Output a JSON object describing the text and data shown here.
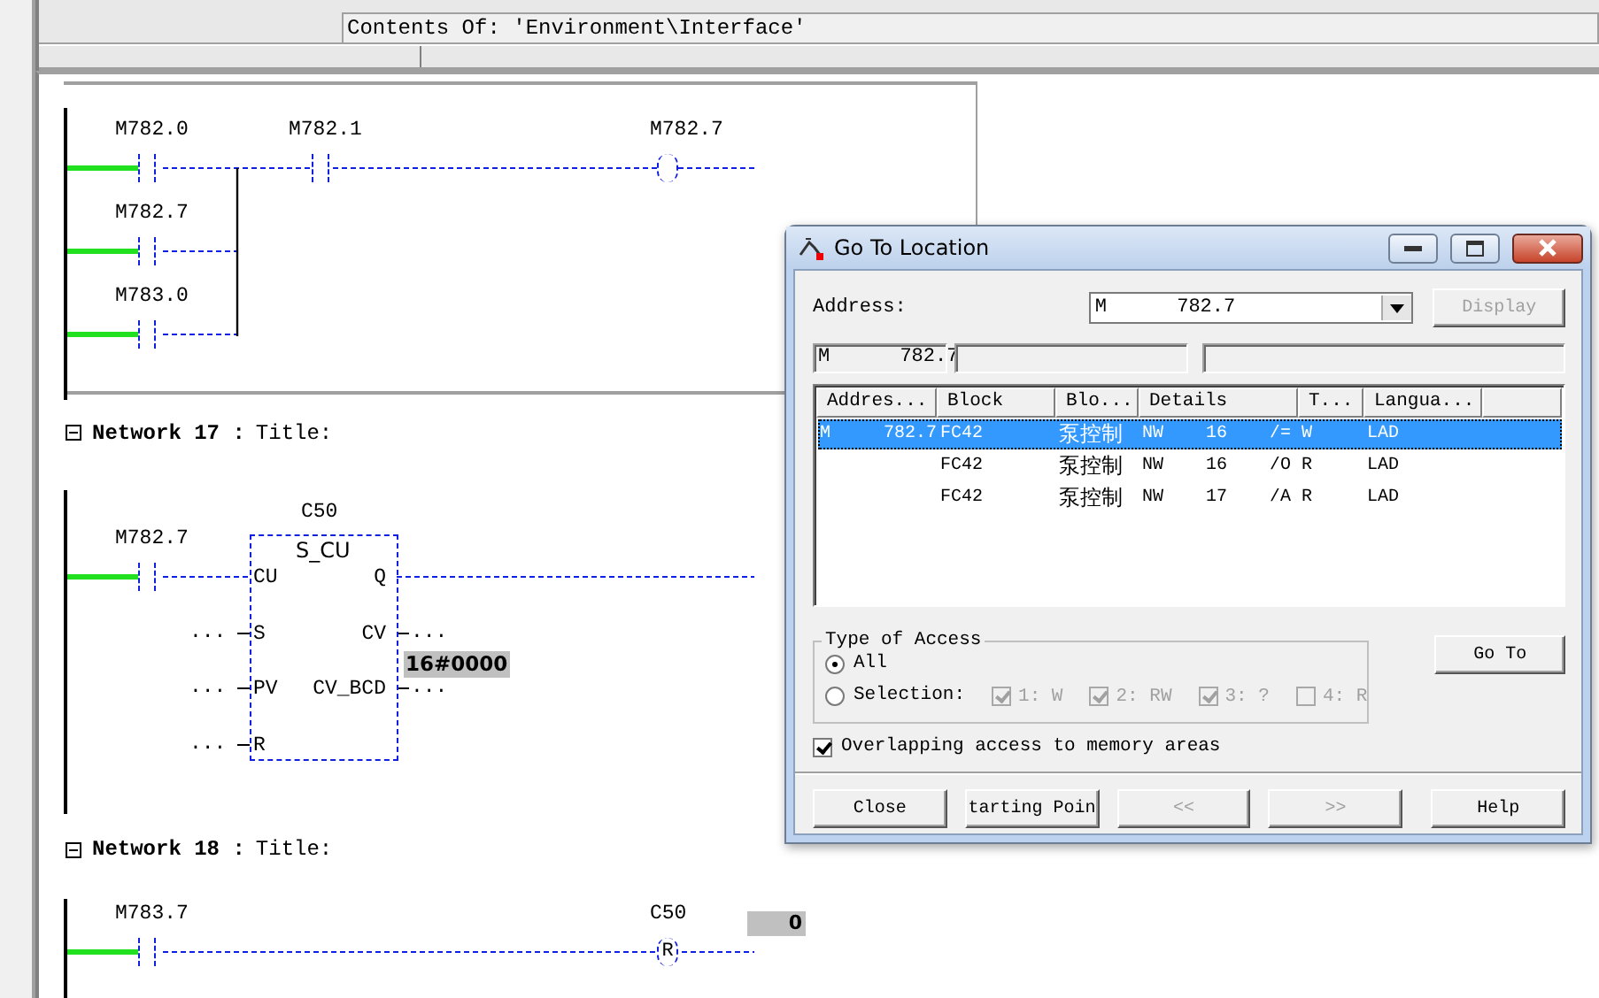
{
  "explorer": {
    "contents_label": "Contents Of: 'Environment\\Interface'"
  },
  "networks": [
    {
      "elements": [
        {
          "kind": "contact",
          "label": "M782.0"
        },
        {
          "kind": "contact",
          "label": "M782.7"
        },
        {
          "kind": "contact",
          "label": "M783.0"
        },
        {
          "kind": "contact",
          "label": "M782.1"
        },
        {
          "kind": "coil",
          "label": "M782.7"
        }
      ]
    },
    {
      "heading": "Network 17 :",
      "title": "Title:",
      "elements": [
        {
          "kind": "contact",
          "label": "M782.7"
        },
        {
          "kind": "counter",
          "label": "C50",
          "type": "S_CU",
          "inputs": [
            {
              "pin": "CU"
            },
            {
              "pin": "S",
              "wire": "..."
            },
            {
              "pin": "PV",
              "wire": "..."
            },
            {
              "pin": "R",
              "wire": "..."
            }
          ],
          "outputs": [
            {
              "pin": "Q"
            },
            {
              "pin": "CV",
              "wire": "..."
            },
            {
              "pin": "CV_BCD",
              "wire": "..."
            }
          ],
          "status": "16#0000"
        }
      ]
    },
    {
      "heading": "Network 18 :",
      "title": "Title:",
      "elements": [
        {
          "kind": "contact",
          "label": "M783.7"
        },
        {
          "kind": "coil",
          "label": "C50",
          "symbol": "R",
          "status": "0"
        }
      ]
    }
  ],
  "dialog": {
    "title": "Go To Location",
    "address_label": "Address:",
    "address_value": "M      782.7",
    "display_button": {
      "label": "Display",
      "disabled": true
    },
    "info_fields": [
      "M      782.7"
    ],
    "list": {
      "columns": [
        "Addres...",
        "Block",
        "Blo...",
        "Details",
        "T...",
        "Langua..."
      ],
      "rows": [
        {
          "address": "M     782.7",
          "block": "FC42",
          "block_name": "泵控制",
          "details": "NW    16    /=",
          "type": "W",
          "language": "LAD",
          "selected": true
        },
        {
          "block": "FC42",
          "block_name": "泵控制",
          "details": "NW    16    /O",
          "type": "R",
          "language": "LAD",
          "selected": false
        },
        {
          "block": "FC42",
          "block_name": "泵控制",
          "details": "NW    17    /A",
          "type": "R",
          "language": "LAD",
          "selected": false
        }
      ]
    },
    "access": {
      "legend": "Type of Access",
      "options": [
        {
          "label": "All",
          "selected": true
        },
        {
          "label": "Selection:",
          "selected": false
        }
      ],
      "filters": [
        {
          "label": "1: W",
          "checked": true,
          "disabled": true
        },
        {
          "label": "2: RW",
          "checked": true,
          "disabled": true
        },
        {
          "label": "3: ?",
          "checked": true,
          "disabled": true
        },
        {
          "label": "4: R",
          "checked": false,
          "disabled": true
        }
      ]
    },
    "goto_button": "Go To",
    "overlap": {
      "label": "Overlapping access to memory areas",
      "checked": true
    },
    "buttons": [
      {
        "label": "Close",
        "disabled": false
      },
      {
        "label": "tarting Poin",
        "disabled": false
      },
      {
        "label": "<<",
        "disabled": true
      },
      {
        "label": ">>",
        "disabled": true
      },
      {
        "label": "Help",
        "disabled": false
      }
    ]
  }
}
